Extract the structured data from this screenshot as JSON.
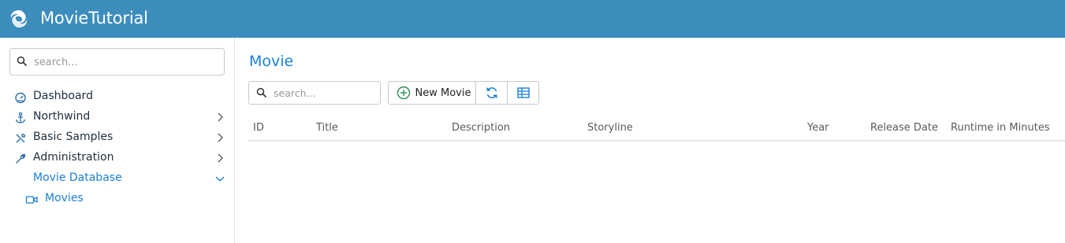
{
  "app": {
    "title": "MovieTutorial"
  },
  "sidebar": {
    "search_placeholder": "search...",
    "items": [
      {
        "label": "Dashboard",
        "icon": "dashboard-icon",
        "has_children": false
      },
      {
        "label": "Northwind",
        "icon": "anchor-icon",
        "has_children": true
      },
      {
        "label": "Basic Samples",
        "icon": "wrench-screwdriver-icon",
        "has_children": true
      },
      {
        "label": "Administration",
        "icon": "wrench-icon",
        "has_children": true
      },
      {
        "label": "Movie Database",
        "icon": "",
        "has_children": true,
        "expanded": true,
        "children": [
          {
            "label": "Movies",
            "icon": "video-camera-icon"
          }
        ]
      }
    ]
  },
  "page": {
    "title": "Movie",
    "search_placeholder": "search...",
    "toolbar": {
      "new_label": "New Movie",
      "refresh_icon": "refresh-icon",
      "columns_icon": "column-picker-icon"
    },
    "columns": [
      "ID",
      "Title",
      "Description",
      "Storyline",
      "Year",
      "Release Date",
      "Runtime in Minutes"
    ]
  },
  "colors": {
    "header_bg": "#3c8dbc",
    "accent": "#1a7fd6",
    "add_green": "#2e8b57"
  }
}
